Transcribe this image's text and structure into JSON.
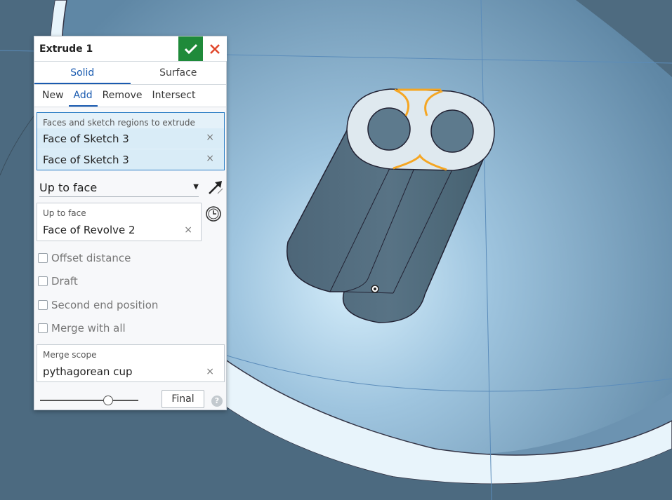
{
  "viewport": {
    "background": "#6f98b6"
  },
  "dialog": {
    "title": "Extrude 1",
    "colors": {
      "accent": "#1a5bb0",
      "ok": "#1f8a3a",
      "cancel": "#e0462a"
    },
    "tabs": [
      {
        "label": "Solid",
        "active": true
      },
      {
        "label": "Surface",
        "active": false
      }
    ],
    "operations": [
      {
        "label": "New",
        "active": false
      },
      {
        "label": "Add",
        "active": true
      },
      {
        "label": "Remove",
        "active": false
      },
      {
        "label": "Intersect",
        "active": false
      }
    ],
    "selection": {
      "label": "Faces and sketch regions to extrude",
      "items": [
        "Face of Sketch 3",
        "Face of Sketch 3"
      ]
    },
    "end_type": {
      "value": "Up to face"
    },
    "up_to_face": {
      "label": "Up to face",
      "value": "Face of Revolve 2"
    },
    "checkboxes": [
      {
        "label": "Offset distance",
        "checked": false
      },
      {
        "label": "Draft",
        "checked": false
      },
      {
        "label": "Second end position",
        "checked": false
      },
      {
        "label": "Merge with all",
        "checked": false
      }
    ],
    "merge_scope": {
      "label": "Merge scope",
      "value": "pythagorean cup"
    },
    "final_label": "Final",
    "help_glyph": "?",
    "clear_glyph": "×",
    "caret_glyph": "▼",
    "icons": [
      "check-icon",
      "close-icon",
      "arrow-icon",
      "clock-icon",
      "help-icon"
    ]
  }
}
